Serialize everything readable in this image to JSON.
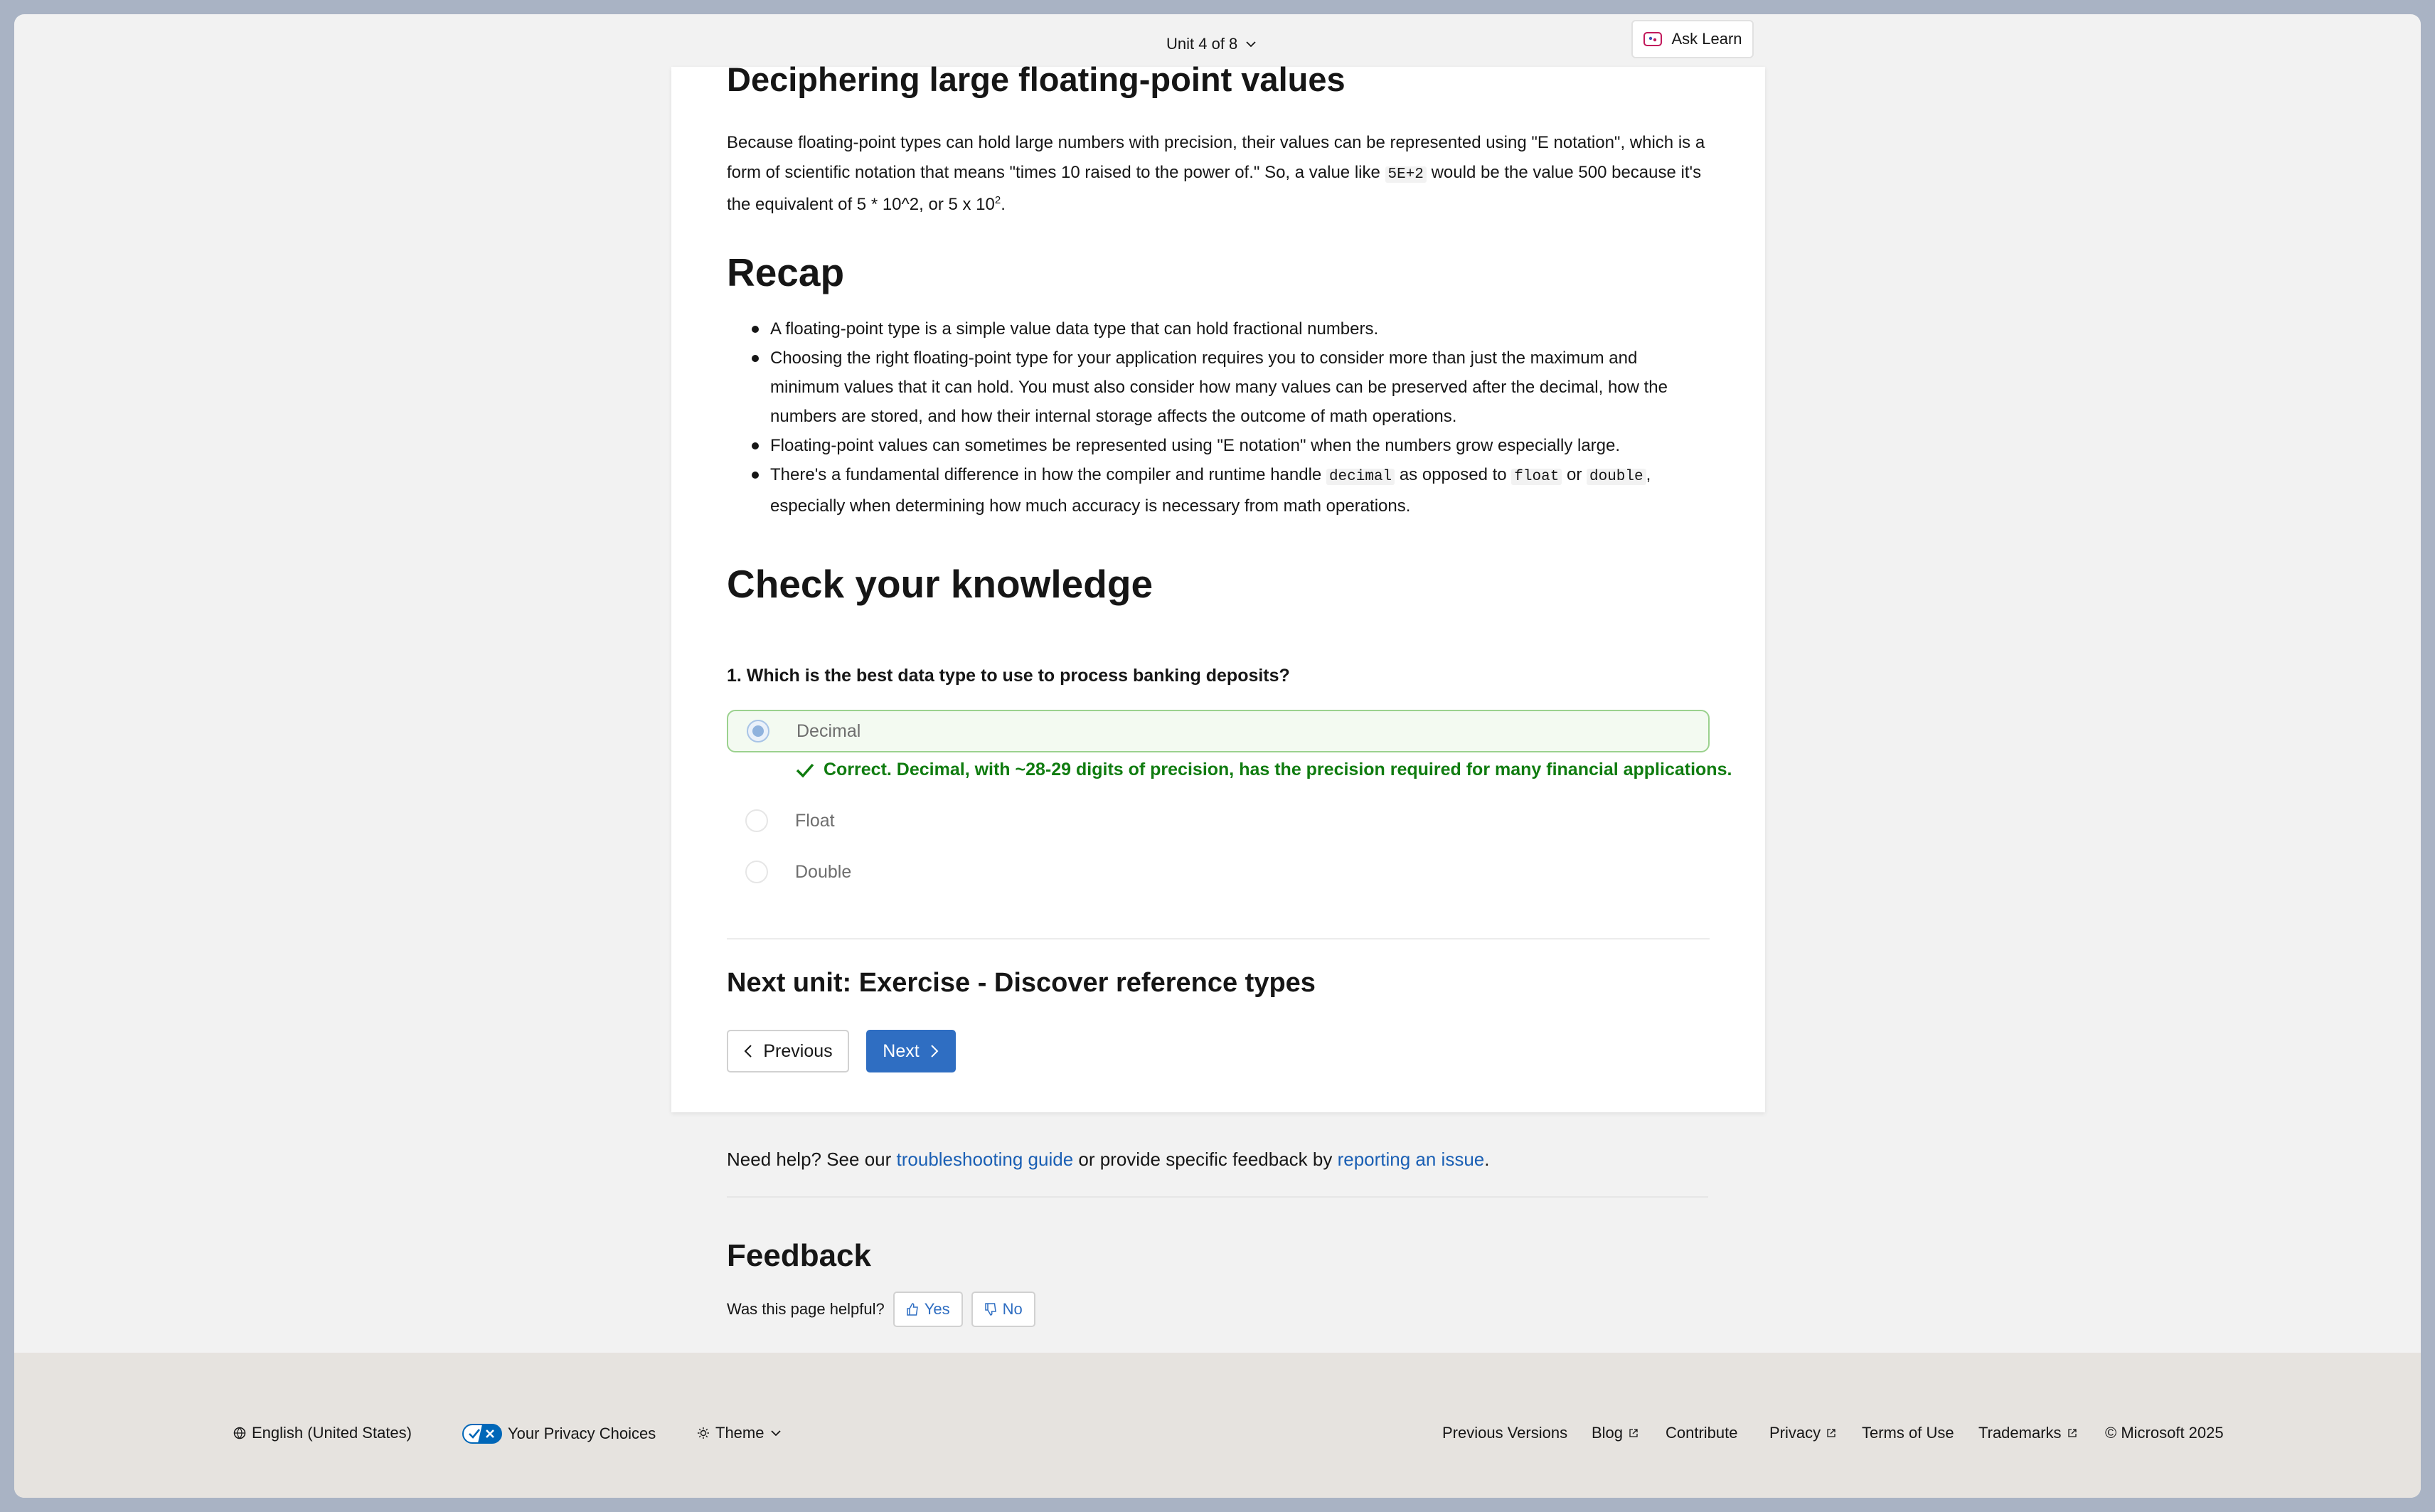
{
  "topbar": {
    "unit_label": "Unit 4 of 8",
    "ask_learn": "Ask Learn"
  },
  "article": {
    "partial_heading": "Deciphering large floating-point values",
    "para_1": "Because floating-point types can hold large numbers with precision, their values can be represented using \"E notation\", which is a form of scientific notation that means \"times 10 raised to the power of.\" So, a value like ",
    "para_code": "5E+2",
    "para_2": " would be the value 500 because it's the equivalent of 5 * 10^2, or 5 x 10",
    "para_sup": "2",
    "para_end": ".",
    "recap_heading": "Recap",
    "recap_items": [
      "A floating-point type is a simple value data type that can hold fractional numbers.",
      "Choosing the right floating-point type for your application requires you to consider more than just the maximum and minimum values that it can hold. You must also consider how many values can be preserved after the decimal, how the numbers are stored, and how their internal storage affects the outcome of math operations.",
      "Floating-point values can sometimes be represented using \"E notation\" when the numbers grow especially large."
    ],
    "recap_last": {
      "t1": "There's a fundamental difference in how the compiler and runtime handle ",
      "c1": "decimal",
      "t2": " as opposed to ",
      "c2": "float",
      "t3": " or ",
      "c3": "double",
      "t4": ", especially when determining how much accuracy is necessary from math operations."
    },
    "check_heading": "Check your knowledge",
    "question": "1. Which is the best data type to use to process banking deposits?",
    "options": [
      "Decimal",
      "Float",
      "Double"
    ],
    "correct_feedback": "Correct. Decimal, with ~28-29 digits of precision, has the precision required for many financial applications.",
    "next_unit": "Next unit: Exercise - Discover reference types",
    "prev_button": "Previous",
    "next_button": "Next"
  },
  "help": {
    "text_1": "Need help? See our ",
    "link_1": "troubleshooting guide",
    "text_2": " or provide specific feedback by ",
    "link_2": "reporting an issue",
    "text_3": "."
  },
  "feedback": {
    "heading": "Feedback",
    "question": "Was this page helpful?",
    "yes": "Yes",
    "no": "No"
  },
  "footer": {
    "language": "English (United States)",
    "privacy_choices": "Your Privacy Choices",
    "theme": "Theme",
    "links": [
      "Previous Versions",
      "Blog",
      "Contribute",
      "Privacy",
      "Terms of Use",
      "Trademarks"
    ],
    "copyright": "© Microsoft 2025"
  },
  "colors": {
    "accent": "#2f6ec2",
    "success": "#107c10",
    "link": "#1a5fb4"
  }
}
